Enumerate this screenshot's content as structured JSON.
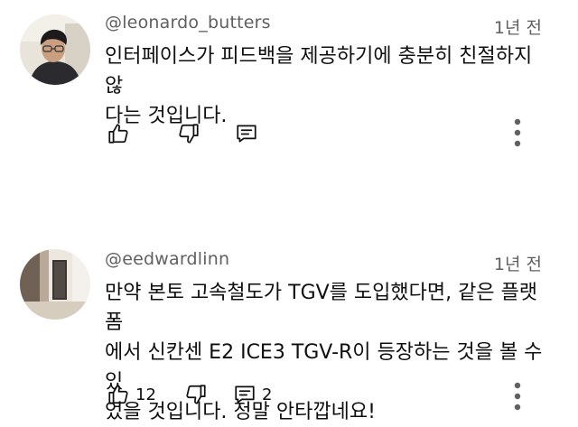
{
  "comments": [
    {
      "author": "@leonardo_butters",
      "time": "1년 전",
      "text_line1": "인터페이스가 피드백을 제공하기에 충분히 친절하지 않",
      "text_line2": "다는 것입니다.",
      "likes": "",
      "replies": "",
      "icons": [
        "thumbs-up-icon",
        "thumbs-down-icon",
        "reply-icon",
        "more-vert-icon"
      ]
    },
    {
      "author": "@eedwardlinn",
      "time": "1년 전",
      "text_line1": "만약 본토 고속철도가 TGV를 도입했다면, 같은 플랫폼",
      "text_line2": "에서 신칸센 E2 ICE3 TGV-R이 등장하는 것을 볼 수 있",
      "text_line3": "었을 것입니다. 정말 안타깝네요!",
      "likes": "12",
      "replies": "2",
      "icons": [
        "thumbs-up-icon",
        "thumbs-down-icon",
        "reply-icon",
        "more-vert-icon"
      ]
    }
  ]
}
